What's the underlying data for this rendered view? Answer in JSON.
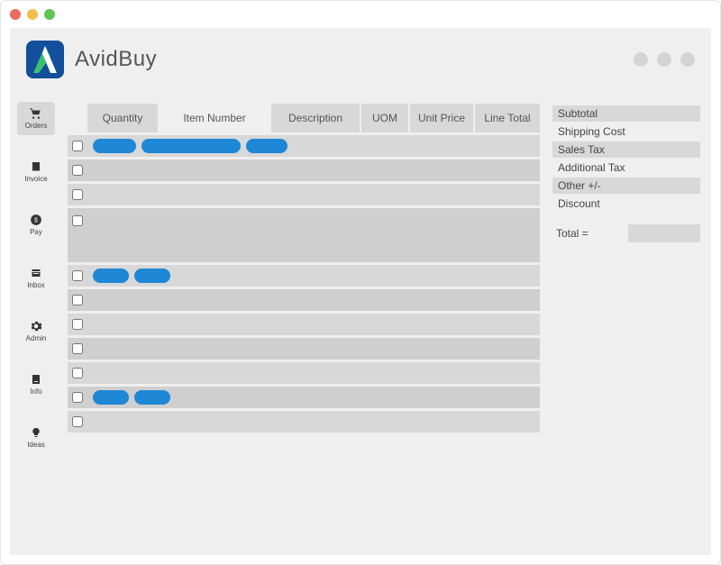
{
  "app": {
    "name": "AvidBuy"
  },
  "sidebar": {
    "items": [
      {
        "label": "Orders",
        "icon": "cart-icon"
      },
      {
        "label": "Invoice",
        "icon": "receipt-icon"
      },
      {
        "label": "Pay",
        "icon": "money-icon"
      },
      {
        "label": "Inbox",
        "icon": "inbox-icon"
      },
      {
        "label": "Admin",
        "icon": "gear-icon"
      },
      {
        "label": "Info",
        "icon": "info-icon"
      },
      {
        "label": "Ideas",
        "icon": "bulb-icon"
      }
    ],
    "active_index": 0
  },
  "table": {
    "columns": {
      "quantity": "Quantity",
      "item_number": "Item Number",
      "description": "Description",
      "uom": "UOM",
      "unit_price": "Unit Price",
      "line_total": "Line Total"
    }
  },
  "summary": {
    "subtotal": "Subtotal",
    "shipping_cost": "Shipping Cost",
    "sales_tax": "Sales Tax",
    "additional_tax": "Additional Tax",
    "other": "Other +/-",
    "discount": "Discount",
    "total_label": "Total ="
  }
}
